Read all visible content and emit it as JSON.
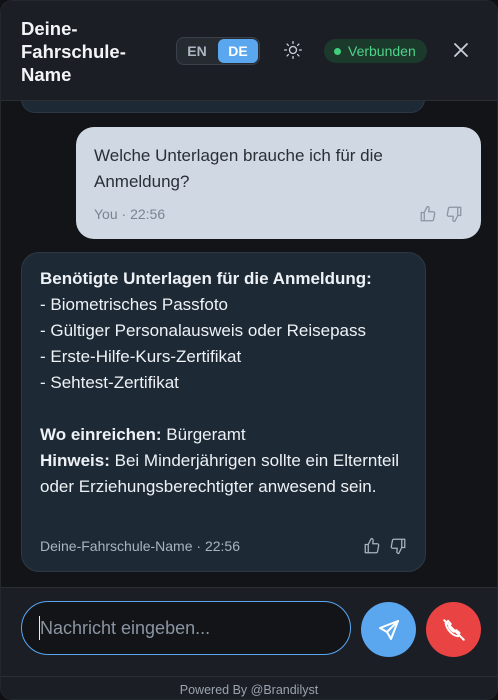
{
  "header": {
    "brand_line1": "Deine-",
    "brand_line2": "Fahrschule-",
    "brand_line3": "Name",
    "lang_en": "EN",
    "lang_de": "DE",
    "active_lang": "DE",
    "theme_icon": "sun-icon",
    "status": "Verbunden",
    "close_icon": "close-icon"
  },
  "messages": {
    "user": {
      "text": "Welche Unterlagen brauche ich für die Anmeldung?",
      "sender": "You",
      "time": "22:56",
      "meta": "You · 22:56"
    },
    "bot": {
      "heading": "Benötigte Unterlagen für die Anmeldung:",
      "items": [
        "- Biometrisches Passfoto",
        "- Gültiger Personalausweis oder Reisepass",
        "- Erste-Hilfe-Kurs-Zertifikat",
        "- Sehtest-Zertifikat"
      ],
      "where_label": "Wo einreichen:",
      "where_value": " Bürgeramt",
      "hint_label": "Hinweis:",
      "hint_value": " Bei Minderjährigen sollte ein Elternteil oder Erziehungsberechtigter anwesend sein.",
      "sender": "Deine-Fahrschule-Name",
      "time": "22:56",
      "meta": "Deine-Fahrschule-Name · 22:56"
    }
  },
  "composer": {
    "placeholder": "Nachricht eingeben...",
    "value": "",
    "send_icon": "send-icon",
    "hangup_icon": "phone-hangup-icon"
  },
  "footer": {
    "powered_by": "Powered By @Brandilyst"
  },
  "colors": {
    "accent": "#5aa7f0",
    "status_green": "#3fcf7d",
    "danger": "#ea4343",
    "user_bubble": "#cfd8e3",
    "bot_bubble": "#1d2a36"
  }
}
